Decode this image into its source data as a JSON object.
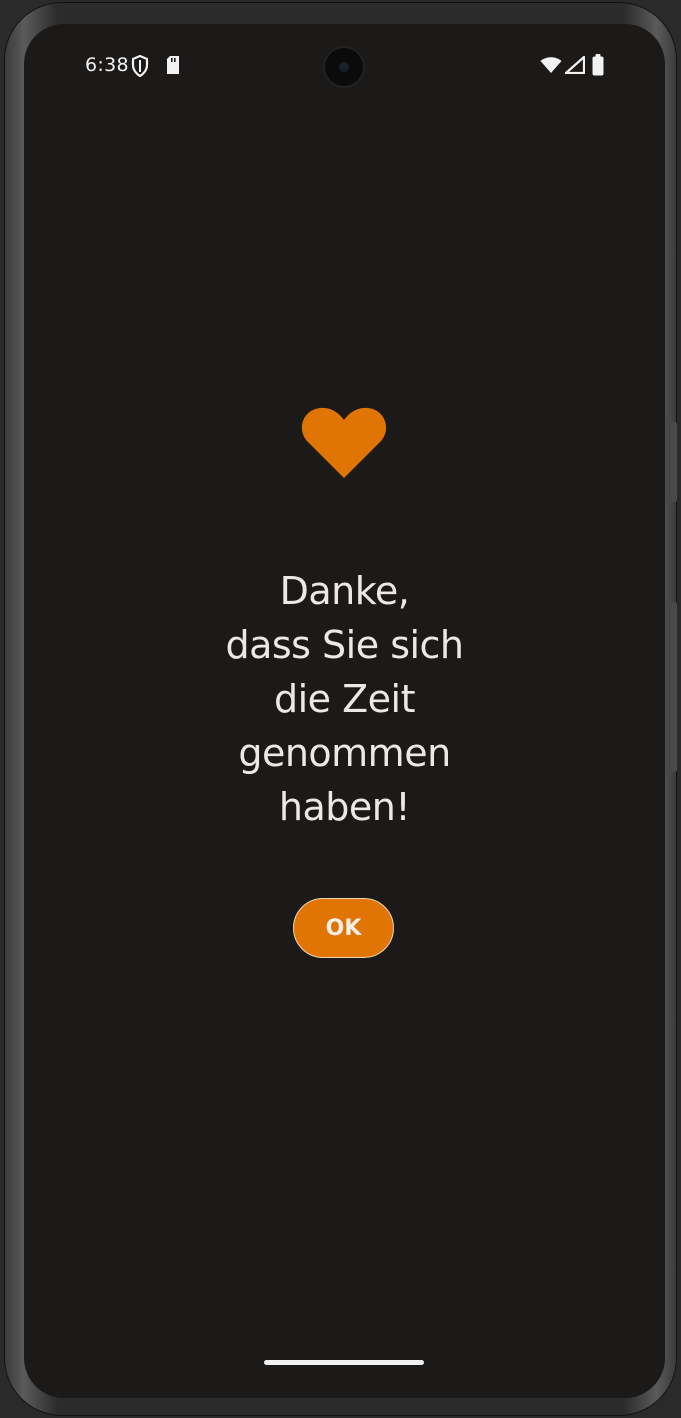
{
  "status_bar": {
    "time": "6:38",
    "icons": [
      "shield-icon",
      "sd-card-icon",
      "wifi-icon",
      "cell-signal-icon",
      "battery-icon"
    ]
  },
  "content": {
    "icon": "heart-icon",
    "message": "Danke,\ndass Sie sich\ndie Zeit\ngenommen\nhaben!",
    "ok_label": "OK"
  },
  "colors": {
    "background": "#1c1a18",
    "accent": "#e07404",
    "text": "#ece8e4"
  }
}
